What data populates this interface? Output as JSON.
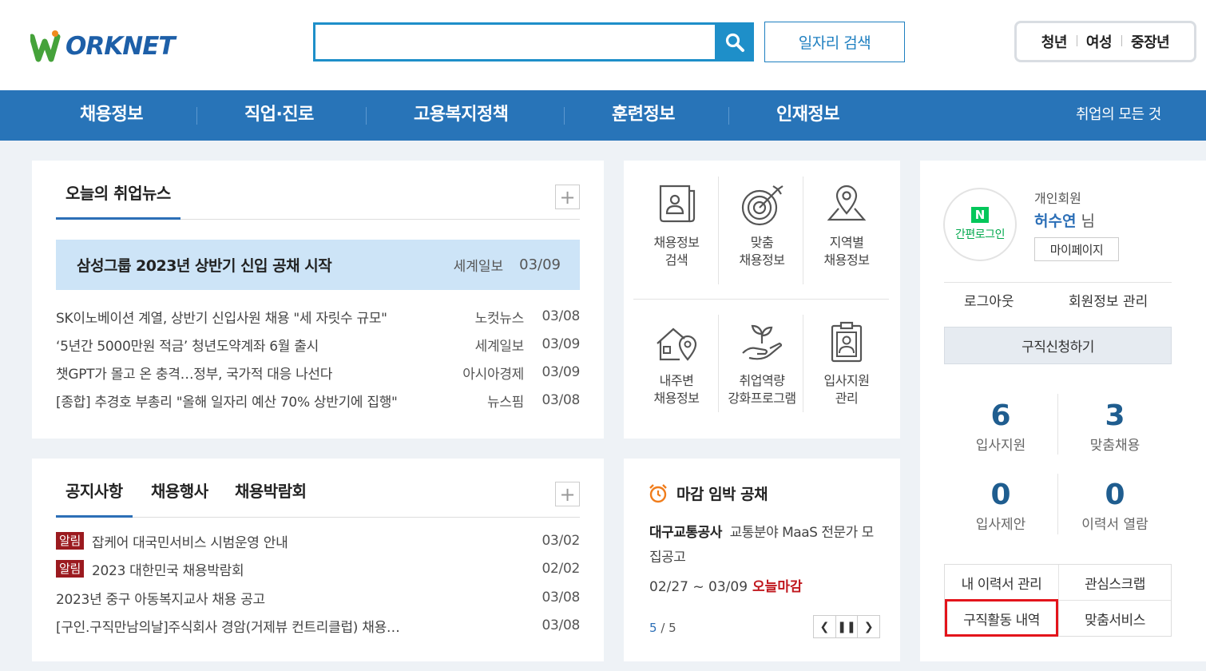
{
  "header": {
    "logo_text": "ORKNET",
    "search_placeholder": "",
    "job_search_label": "일자리 검색",
    "tabs": [
      "청년",
      "여성",
      "중장년"
    ]
  },
  "nav": {
    "items": [
      "채용정보",
      "직업·진로",
      "고용복지정책",
      "훈련정보",
      "인재정보"
    ],
    "all_label": "취업의 모든 것"
  },
  "news": {
    "title": "오늘의 취업뉴스",
    "headline": {
      "title": "삼성그룹 2023년 상반기 신입 공채 시작",
      "source": "세계일보",
      "date": "03/09"
    },
    "items": [
      {
        "title": "SK이노베이션 계열, 상반기 신입사원 채용 \"세 자릿수 규모\"",
        "source": "노컷뉴스",
        "date": "03/08"
      },
      {
        "title": "‘5년간 5000만원 적금’ 청년도약계좌 6월 출시",
        "source": "세계일보",
        "date": "03/09"
      },
      {
        "title": "챗GPT가 몰고 온 충격…정부, 국가적 대응 나선다",
        "source": "아시아경제",
        "date": "03/09"
      },
      {
        "title": "[종합] 추경호 부총리 \"올해 일자리 예산 70% 상반기에 집행\"",
        "source": "뉴스핌",
        "date": "03/08"
      }
    ]
  },
  "notice": {
    "tabs": [
      "공지사항",
      "채용행사",
      "채용박람회"
    ],
    "badge": "알림",
    "items": [
      {
        "title": "잡케어 대국민서비스 시범운영 안내",
        "date": "03/02",
        "badge": true
      },
      {
        "title": "2023 대한민국 채용박람회",
        "date": "02/02",
        "badge": true
      },
      {
        "title": "2023년 중구 아동복지교사 채용 공고",
        "date": "03/08",
        "badge": false
      },
      {
        "title": "[구인.구직만남의날]주식회사 경암(거제뷰 컨트리클럽) 채용…",
        "date": "03/08",
        "badge": false
      }
    ]
  },
  "menu": {
    "items": [
      {
        "l1": "채용정보",
        "l2": "검색",
        "icon": "scroll-person-icon"
      },
      {
        "l1": "맞춤",
        "l2": "채용정보",
        "icon": "target-icon"
      },
      {
        "l1": "지역별",
        "l2": "채용정보",
        "icon": "map-pin-icon"
      },
      {
        "l1": "내주변",
        "l2": "채용정보",
        "icon": "house-pin-icon"
      },
      {
        "l1": "취업역량",
        "l2": "강화프로그램",
        "icon": "hand-sprout-icon"
      },
      {
        "l1": "입사지원",
        "l2": "관리",
        "icon": "clipboard-person-icon"
      }
    ]
  },
  "deadline": {
    "title": "마감 임박 공채",
    "company": "대구교통공사",
    "job": "교통분야 MaaS 전문가 모집공고",
    "period": "02/27 ~ 03/09",
    "today_label": "오늘마감",
    "page_current": "5",
    "page_total": "/ 5"
  },
  "user": {
    "naver_logo": "N",
    "naver_label": "간편로그인",
    "member_type": "개인회원",
    "name": "허수연",
    "name_suffix": "님",
    "mypage_label": "마이페이지",
    "logout_label": "로그아웃",
    "member_edit_label": "회원정보 관리",
    "apply_label": "구직신청하기",
    "stats": [
      {
        "num": "6",
        "label": "입사지원"
      },
      {
        "num": "3",
        "label": "맞춤채용"
      },
      {
        "num": "0",
        "label": "입사제안"
      },
      {
        "num": "0",
        "label": "이력서 열람"
      }
    ],
    "buttons": [
      "내 이력서 관리",
      "관심스크랩",
      "구직활동 내역",
      "맞춤서비스"
    ]
  },
  "colors": {
    "brand_blue": "#2874b8",
    "search_blue": "#1e8fc9",
    "headline_bg": "#cde4f7",
    "badge_red": "#9b1a1f",
    "highlight_red": "#e3141b",
    "stat_num": "#1f5d8f"
  }
}
